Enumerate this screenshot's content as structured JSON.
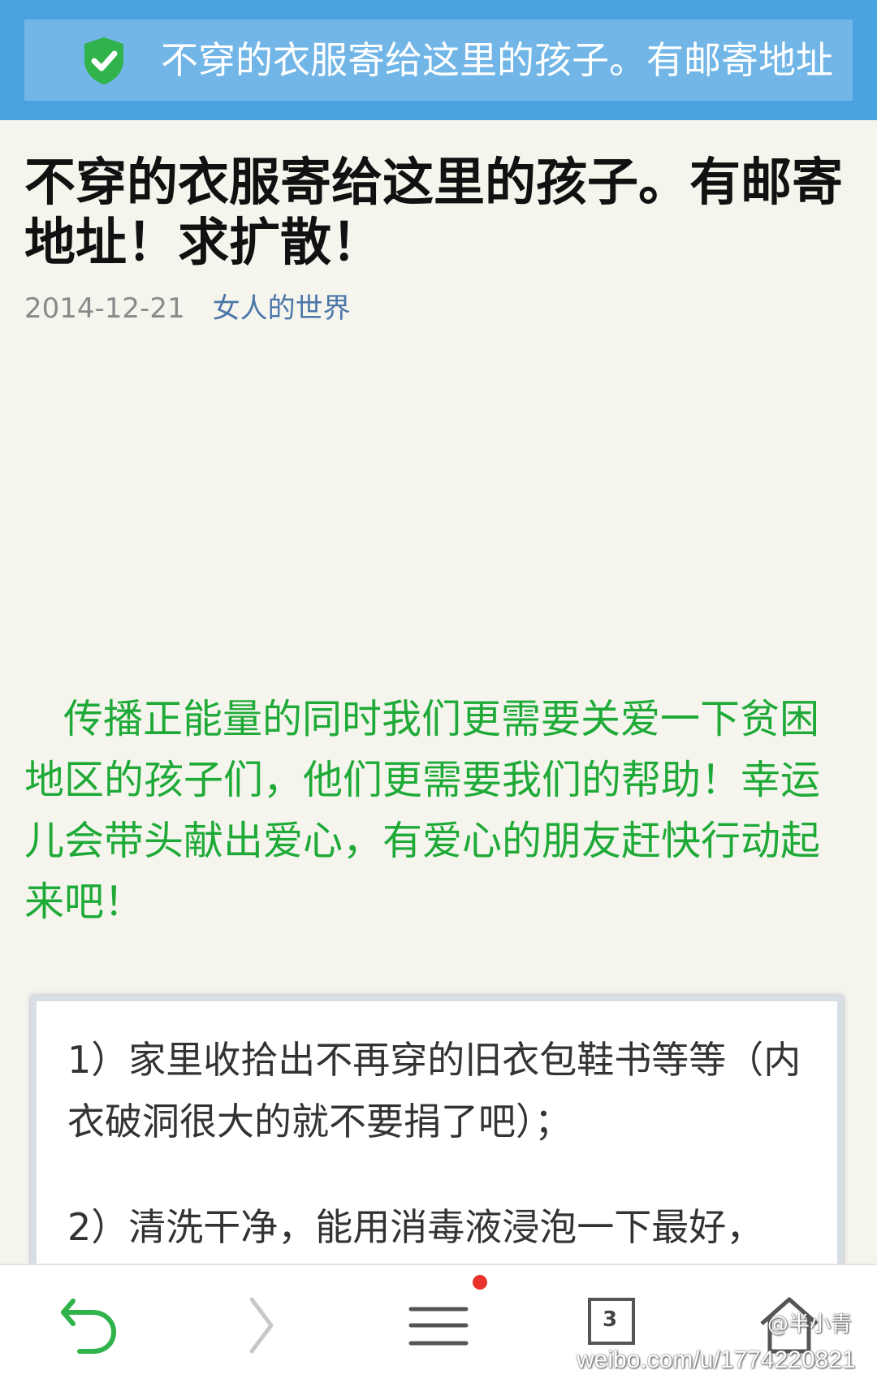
{
  "browser": {
    "url_title": "不穿的衣服寄给这里的孩子。有邮寄地址",
    "secure_icon": "shield-check-icon"
  },
  "article": {
    "title": "不穿的衣服寄给这里的孩子。有邮寄地址！求扩散！",
    "date": "2014-12-21",
    "source": "女人的世界",
    "green_paragraph": "传播正能量的同时我们更需要关爱一下贫困地区的孩子们，他们更需要我们的帮助！幸运儿会带头献出爱心，有爱心的朋友赶快行动起来吧！",
    "steps": [
      "1）家里收拾出不再穿的旧衣包鞋书等等（内衣破洞很大的就不要捐了吧）；",
      "2）清洗干净，能用消毒液浸泡一下最好，"
    ]
  },
  "bottom_nav": {
    "tab_count": "3",
    "icons": [
      "back-icon",
      "forward-icon",
      "menu-icon",
      "tabs-icon",
      "home-icon"
    ]
  },
  "watermark": {
    "url": "weibo.com/u/1774220821",
    "user": "@半小青"
  },
  "colors": {
    "topbar": "#4ba2e0",
    "accent_green": "#1faa38",
    "link_blue": "#4a76a8",
    "badge_red": "#e8322b"
  }
}
